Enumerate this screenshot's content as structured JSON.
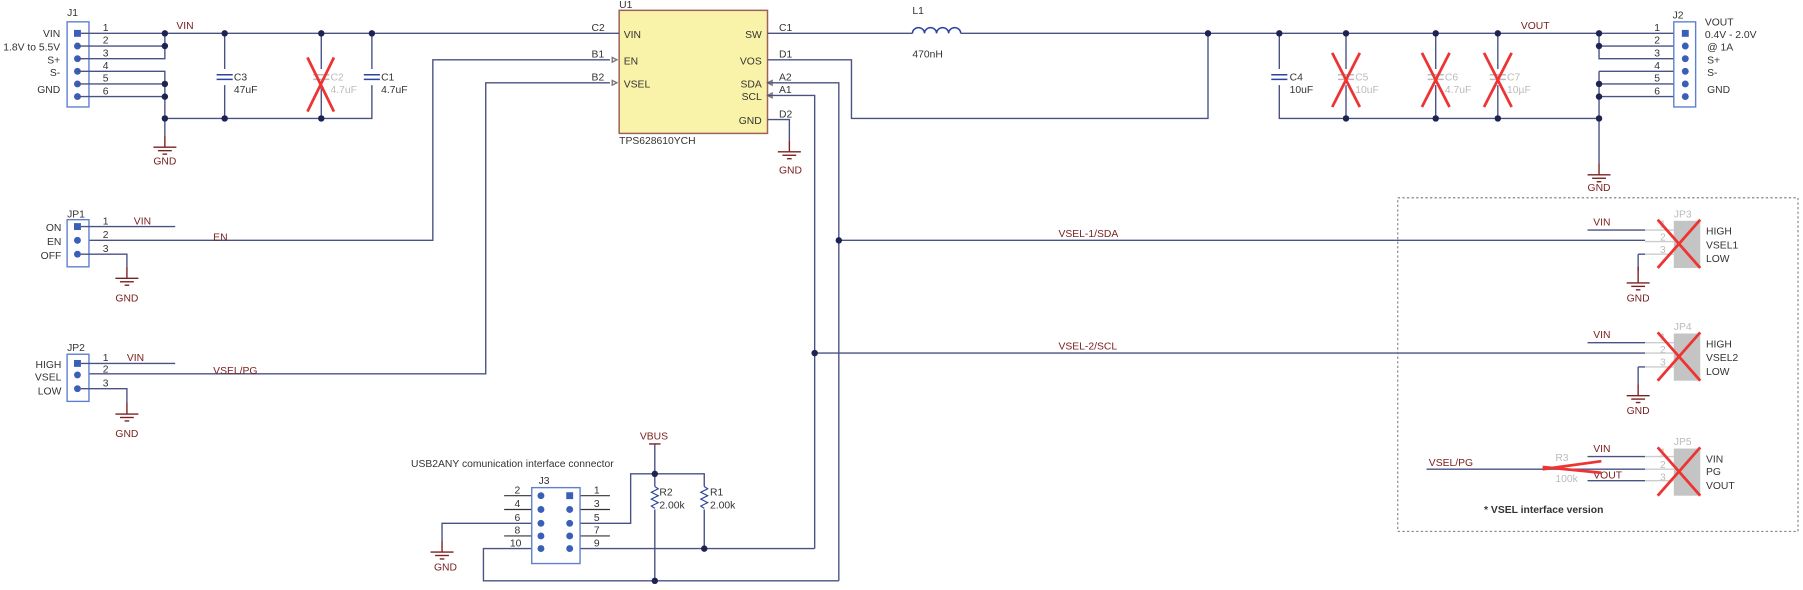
{
  "nets": {
    "vin": "VIN",
    "vout": "VOUT",
    "en": "EN",
    "vsel_pg": "VSEL/PG",
    "vsel1_sda": "VSEL-1/SDA",
    "vsel2_scl": "VSEL-2/SCL",
    "gnd": "GND",
    "vbus": "VBUS"
  },
  "j1": {
    "ref": "J1",
    "pins": [
      "1",
      "2",
      "3",
      "4",
      "5",
      "6"
    ],
    "labels": [
      "VIN",
      "1.8V to 5.5V",
      "S+",
      "S-",
      "GND"
    ]
  },
  "j2": {
    "ref": "J2",
    "pins": [
      "1",
      "2",
      "3",
      "4",
      "5",
      "6"
    ],
    "labels": [
      "VOUT",
      "0.4V - 2.0V",
      "@ 1A",
      "S+",
      "S-",
      "GND"
    ]
  },
  "caps": [
    {
      "ref": "C3",
      "value": "47uF",
      "populated": true
    },
    {
      "ref": "C2",
      "value": "4.7uF",
      "populated": false
    },
    {
      "ref": "C1",
      "value": "4.7uF",
      "populated": true
    },
    {
      "ref": "C4",
      "value": "10uF",
      "populated": true
    },
    {
      "ref": "C5",
      "value": "10uF",
      "populated": false
    },
    {
      "ref": "C6",
      "value": "4.7uF",
      "populated": false
    },
    {
      "ref": "C7",
      "value": "10µF",
      "populated": false
    }
  ],
  "u1": {
    "ref": "U1",
    "part": "TPS628610YCH",
    "left_pins": [
      {
        "num": "C2",
        "name": "VIN"
      },
      {
        "num": "B1",
        "name": "EN"
      },
      {
        "num": "B2",
        "name": "VSEL"
      }
    ],
    "right_pins": [
      {
        "num": "C1",
        "name": "SW"
      },
      {
        "num": "D1",
        "name": "VOS"
      },
      {
        "num": "A2",
        "name": "SDA"
      },
      {
        "num": "A1",
        "name": "SCL"
      },
      {
        "num": "D2",
        "name": "GND"
      }
    ]
  },
  "l1": {
    "ref": "L1",
    "value": "470nH"
  },
  "jp1": {
    "ref": "JP1",
    "pins": [
      "1",
      "2",
      "3"
    ],
    "labels": [
      "ON",
      "EN",
      "OFF"
    ]
  },
  "jp2": {
    "ref": "JP2",
    "pins": [
      "1",
      "2",
      "3"
    ],
    "labels": [
      "HIGH",
      "VSEL",
      "LOW"
    ]
  },
  "jp3": {
    "ref": "JP3",
    "pins": [
      "1",
      "2",
      "3"
    ],
    "labels": [
      "HIGH",
      "VSEL1",
      "LOW"
    ],
    "populated": false
  },
  "jp4": {
    "ref": "JP4",
    "pins": [
      "1",
      "2",
      "3"
    ],
    "labels": [
      "HIGH",
      "VSEL2",
      "LOW"
    ],
    "populated": false
  },
  "jp5": {
    "ref": "JP5",
    "pins": [
      "1",
      "2",
      "3"
    ],
    "labels": [
      "VIN",
      "PG",
      "VOUT"
    ],
    "populated": false
  },
  "r3": {
    "ref": "R3",
    "value": "100k",
    "populated": false
  },
  "r1": {
    "ref": "R1",
    "value": "2.00k"
  },
  "r2": {
    "ref": "R2",
    "value": "2.00k"
  },
  "j3": {
    "ref": "J3",
    "title": "USB2ANY comunication interface connector",
    "left_pins": [
      "2",
      "4",
      "6",
      "8",
      "10"
    ],
    "right_pins": [
      "1",
      "3",
      "5",
      "7",
      "9"
    ]
  },
  "note": "* VSEL interface version",
  "colors": {
    "wire": "#4a5285",
    "net_label": "#7a2020",
    "ic_fill": "#f9f3a9",
    "dnp_cross": "#ee3333",
    "junction": "#1e2452"
  }
}
